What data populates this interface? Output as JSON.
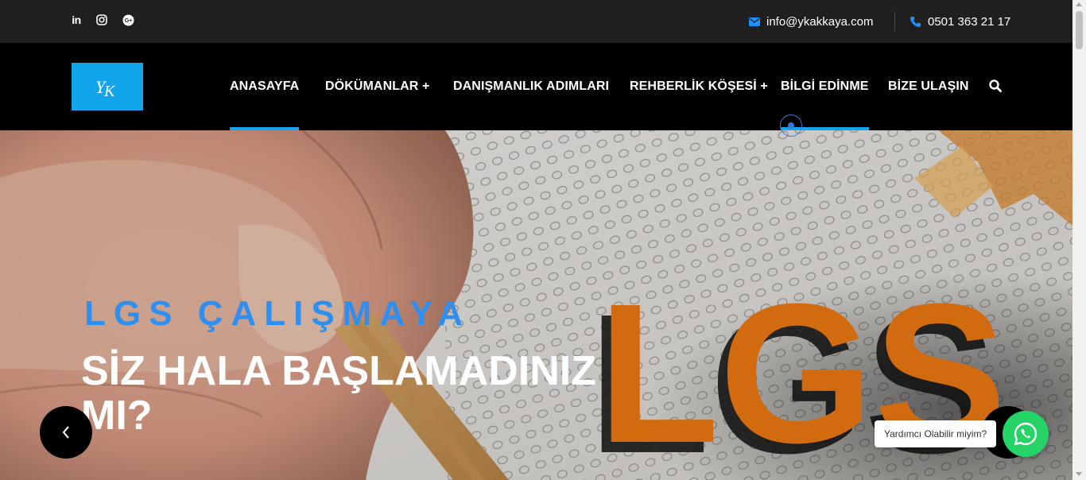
{
  "topbar": {
    "social": [
      {
        "name": "linkedin",
        "label": "in"
      },
      {
        "name": "instagram",
        "label": ""
      },
      {
        "name": "google-plus",
        "label": "G+"
      }
    ],
    "email": "info@ykakkaya.com",
    "phone": "0501 363 21 17"
  },
  "nav": {
    "logo_text": "YK",
    "items": [
      {
        "label": "ANASAYFA",
        "active": true
      },
      {
        "label": "DÖKÜMANLAR +",
        "active": false
      },
      {
        "label": "DANIŞMANLIK ADIMLARI",
        "active": false
      },
      {
        "label": "REHBERLİK KÖŞESİ +",
        "active": false
      },
      {
        "label": "BİLGİ EDİNME",
        "active": false
      },
      {
        "label": "BİZE ULAŞIN",
        "active": false
      }
    ],
    "accent_color": "#13a6ee"
  },
  "hero": {
    "subtitle": "LGS ÇALIŞMAYA",
    "title": "SİZ HALA BAŞLAMADINIZ MI?",
    "image_text": "LGS",
    "subtitle_color": "#2f8ff0",
    "image_text_color": "#f07a12"
  },
  "chat": {
    "bubble_text": "Yardımcı Olabilir miyim?",
    "button_icon": "whatsapp-icon",
    "button_color": "#25d366"
  }
}
